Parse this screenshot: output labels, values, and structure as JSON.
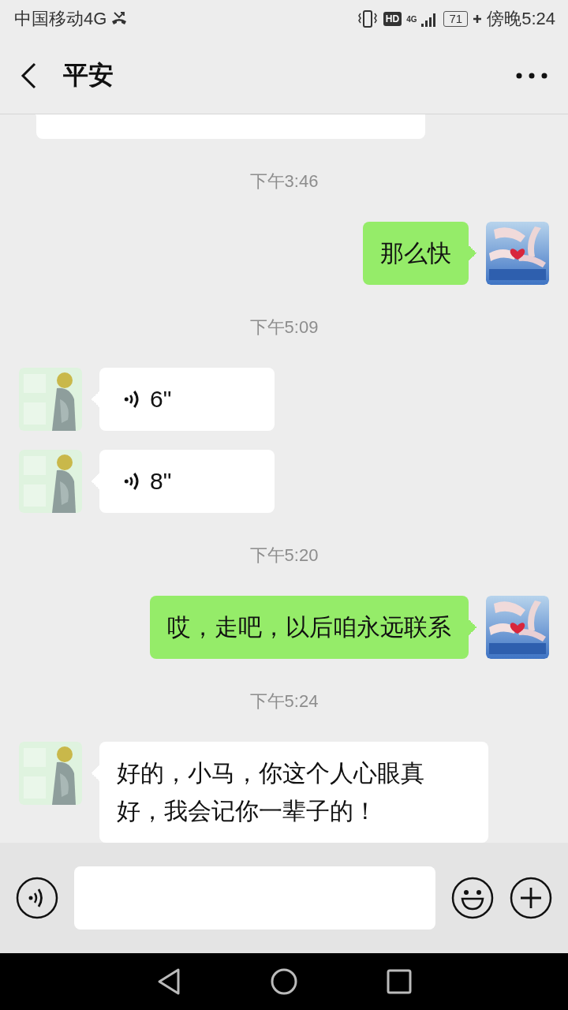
{
  "status_bar": {
    "carrier": "中国移动4G",
    "hd_badge": "HD",
    "network": "4G",
    "battery": "71",
    "time": "傍晚5:24"
  },
  "header": {
    "title": "平安"
  },
  "messages": [
    {
      "kind": "cut",
      "outgoing": false
    },
    {
      "kind": "timestamp",
      "text": "下午3:46"
    },
    {
      "kind": "text",
      "outgoing": true,
      "text": "那么快"
    },
    {
      "kind": "timestamp",
      "text": "下午5:09"
    },
    {
      "kind": "voice",
      "outgoing": false,
      "text": "6\""
    },
    {
      "kind": "voice",
      "outgoing": false,
      "text": "8\""
    },
    {
      "kind": "timestamp",
      "text": "下午5:20"
    },
    {
      "kind": "text",
      "outgoing": true,
      "text": "哎，走吧，以后咱永远联系"
    },
    {
      "kind": "timestamp",
      "text": "下午5:24"
    },
    {
      "kind": "text",
      "outgoing": false,
      "text": "好的，小马，你这个人心眼真好，我会记你一辈子的！"
    }
  ]
}
